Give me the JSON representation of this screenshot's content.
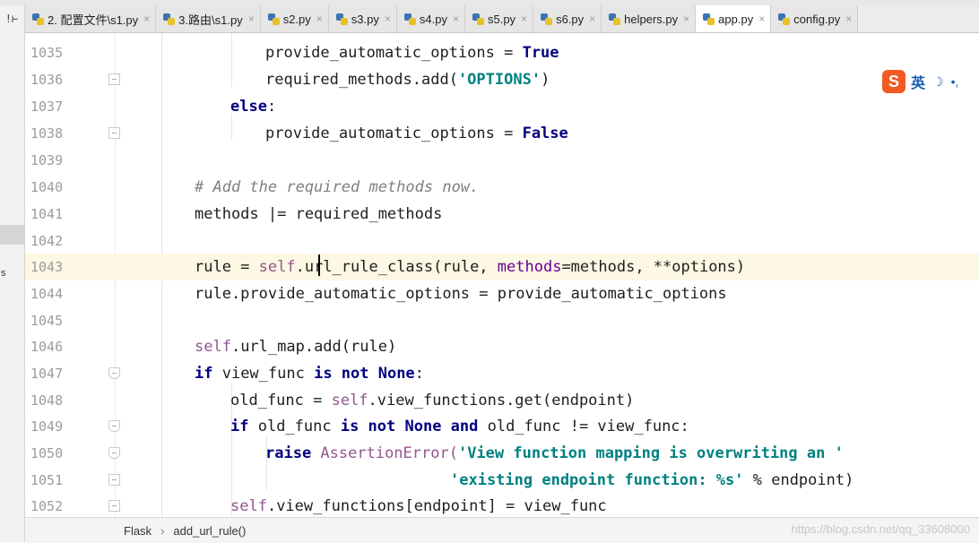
{
  "tabs": [
    {
      "label": "2. 配置文件\\s1.py",
      "active": false
    },
    {
      "label": "3.路由\\s1.py",
      "active": false
    },
    {
      "label": "s2.py",
      "active": false
    },
    {
      "label": "s3.py",
      "active": false
    },
    {
      "label": "s4.py",
      "active": false
    },
    {
      "label": "s5.py",
      "active": false
    },
    {
      "label": "s6.py",
      "active": false
    },
    {
      "label": "helpers.py",
      "active": false
    },
    {
      "label": "app.py",
      "active": true
    },
    {
      "label": "config.py",
      "active": false
    }
  ],
  "left_toolbar": {
    "tool_icon": "!⊢",
    "side_mark": "s"
  },
  "ime": {
    "logo": "S",
    "lang": "英",
    "moon": "☽",
    "dot": "•,"
  },
  "editor": {
    "current_line": "1043",
    "lines": [
      {
        "no": "1035",
        "fold": "",
        "indent": 2
      },
      {
        "no": "1036",
        "fold": "end",
        "indent": 2
      },
      {
        "no": "1037",
        "fold": "",
        "indent": 1
      },
      {
        "no": "1038",
        "fold": "end",
        "indent": 2
      },
      {
        "no": "1039",
        "fold": "",
        "indent": 0
      },
      {
        "no": "1040",
        "fold": "",
        "indent": 0
      },
      {
        "no": "1041",
        "fold": "",
        "indent": 0
      },
      {
        "no": "1042",
        "fold": "",
        "indent": 0
      },
      {
        "no": "1043",
        "fold": "",
        "indent": 0
      },
      {
        "no": "1044",
        "fold": "",
        "indent": 0
      },
      {
        "no": "1045",
        "fold": "",
        "indent": 0
      },
      {
        "no": "1046",
        "fold": "",
        "indent": 0
      },
      {
        "no": "1047",
        "fold": "start",
        "indent": 0
      },
      {
        "no": "1048",
        "fold": "",
        "indent": 1
      },
      {
        "no": "1049",
        "fold": "start",
        "indent": 1
      },
      {
        "no": "1050",
        "fold": "start",
        "indent": 2
      },
      {
        "no": "1051",
        "fold": "end",
        "indent": 2
      },
      {
        "no": "1052",
        "fold": "end",
        "indent": 1
      }
    ],
    "code": {
      "l1035": {
        "a": "provide_automatic_options = ",
        "b": "True"
      },
      "l1036": {
        "a": "required_methods.add(",
        "b": "'OPTIONS'",
        "c": ")"
      },
      "l1037": {
        "a": "else",
        "b": ":"
      },
      "l1038": {
        "a": "provide_automatic_options = ",
        "b": "False"
      },
      "l1040": {
        "a": "# Add the required methods now."
      },
      "l1041": {
        "a": "methods |= required_methods"
      },
      "l1043": {
        "a": "rule = ",
        "b": "self",
        "c": ".url_rule_class(rule, ",
        "d": "methods",
        "e": "=methods, **options)"
      },
      "l1044": {
        "a": "rule.provide_automatic_options = provide_automatic_options"
      },
      "l1046": {
        "a": "self",
        "b": ".url_map.add(rule)"
      },
      "l1047": {
        "a": "if",
        "b": " view_func ",
        "c": "is not None",
        "d": ":"
      },
      "l1048": {
        "a": "old_func = ",
        "b": "self",
        "c": ".view_functions.get(endpoint)"
      },
      "l1049": {
        "a": "if",
        "b": " old_func ",
        "c": "is not None and",
        "d": " old_func != view_func:"
      },
      "l1050": {
        "a": "raise",
        "b": " AssertionError(",
        "c": "'View function mapping is overwriting an '"
      },
      "l1051": {
        "a": "'existing endpoint function: %s'",
        "b": " % endpoint)"
      },
      "l1052": {
        "a": "self",
        "b": ".view_functions[endpoint] = view_func"
      }
    }
  },
  "statusbar": {
    "crumb1": "Flask",
    "chevron": "›",
    "crumb2": "add_url_rule()"
  },
  "watermark": "https://blog.csdn.net/qq_33608000"
}
